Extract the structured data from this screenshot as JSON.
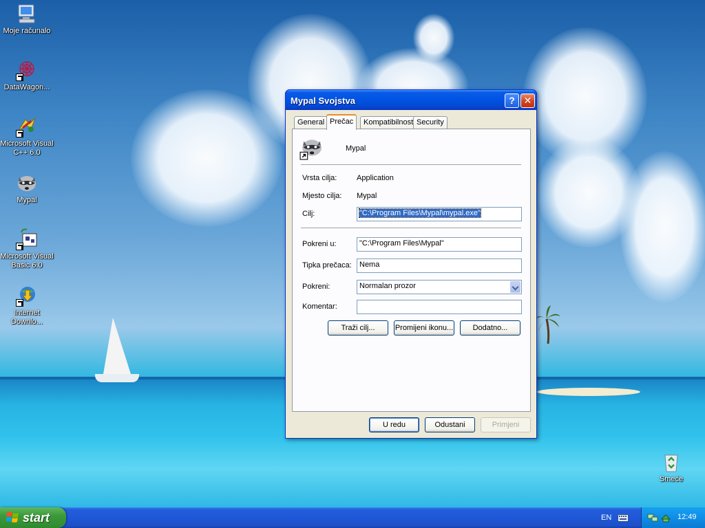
{
  "desktop": {
    "icons": [
      {
        "label": "Moje računalo"
      },
      {
        "label": "DataWagon..."
      },
      {
        "label": "Microsoft Visual C++ 6.0"
      },
      {
        "label": "Mypal"
      },
      {
        "label": "Microsoft Visual Basic 6.0"
      },
      {
        "label": "Internet Downlo..."
      },
      {
        "label": "Smeće"
      }
    ]
  },
  "dialog": {
    "title": "Mypal Svojstva",
    "help_glyph": "?",
    "close_glyph": "✕",
    "tabs": [
      "General",
      "Prečac",
      "Kompatibilnost",
      "Security"
    ],
    "active_tab": "Prečac",
    "app_name": "Mypal",
    "target_type_label": "Vrsta cilja:",
    "target_type_value": "Application",
    "target_location_label": "Mjesto cilja:",
    "target_location_value": "Mypal",
    "target_label": "Cilj:",
    "target_value": "\"C:\\Program Files\\Mypal\\mypal.exe\"",
    "start_in_label": "Pokreni u:",
    "start_in_value": "\"C:\\Program Files\\Mypal\"",
    "shortcut_key_label": "Tipka prečaca:",
    "shortcut_key_value": "Nema",
    "run_label": "Pokreni:",
    "run_value": "Normalan prozor",
    "comment_label": "Komentar:",
    "comment_value": "",
    "find_target_button": "Traži cilj...",
    "change_icon_button": "Promijeni ikonu...",
    "advanced_button": "Dodatno...",
    "ok_button": "U redu",
    "cancel_button": "Odustani",
    "apply_button": "Primjeni"
  },
  "taskbar": {
    "start_label": "start",
    "language": "EN",
    "clock": "12:49"
  },
  "colors": {
    "title_bar": "#0054e3",
    "start_green": "#3c9a3b",
    "taskbar_blue": "#1f57d6",
    "tray_blue": "#0f8ee6",
    "selection": "#316ac5",
    "close_red": "#d5431c"
  }
}
